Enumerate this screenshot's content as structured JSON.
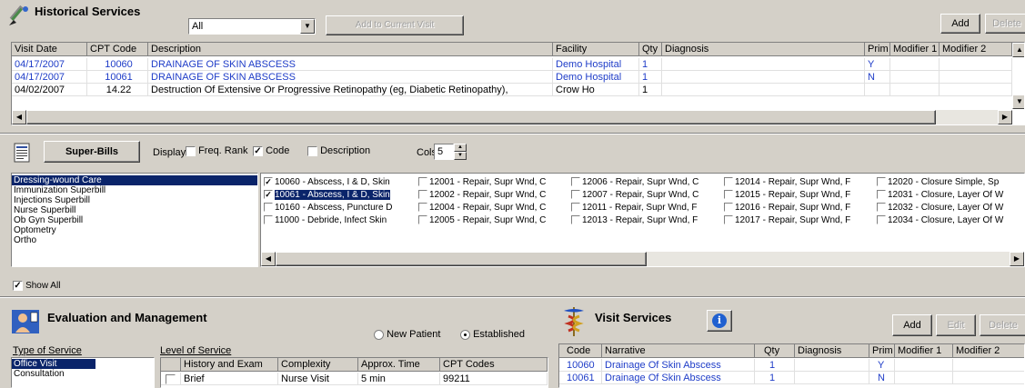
{
  "historical": {
    "title": "Historical Services",
    "filter_value": "All",
    "add_current_label": "Add to Current Visit",
    "add_label": "Add",
    "delete_label": "Delete",
    "columns": [
      "Visit Date",
      "CPT Code",
      "Description",
      "Facility",
      "Qty",
      "Diagnosis",
      "Prim",
      "Modifier 1",
      "Modifier 2"
    ],
    "rows": [
      {
        "date": "04/17/2007",
        "cpt": "10060",
        "desc": "DRAINAGE OF SKIN ABSCESS",
        "facility": "Demo Hospital",
        "qty": "1",
        "diag": "",
        "prim": "Y",
        "mod1": "",
        "mod2": ""
      },
      {
        "date": "04/17/2007",
        "cpt": "10061",
        "desc": "DRAINAGE OF SKIN ABSCESS",
        "facility": "Demo Hospital",
        "qty": "1",
        "diag": "",
        "prim": "N",
        "mod1": "",
        "mod2": ""
      },
      {
        "date": "04/02/2007",
        "cpt": "14.22",
        "desc": "Destruction Of Extensive Or Progressive Retinopathy (eg, Diabetic Retinopathy),",
        "facility": "Crow Ho",
        "qty": "1",
        "diag": "",
        "prim": "",
        "mod1": "",
        "mod2": ""
      }
    ]
  },
  "superbills": {
    "button_label": "Super-Bills",
    "display_label": "Display",
    "freq_rank_label": "Freq. Rank",
    "freq_rank_checked": false,
    "code_label": "Code",
    "code_checked": true,
    "description_label": "Description",
    "description_checked": false,
    "cols_label": "Cols",
    "cols_value": "5",
    "list": [
      "Dressing-wound Care",
      "Immunization Superbill",
      "Injections Superbill",
      "Nurse Superbill",
      "Ob Gyn Superbill",
      "Optometry",
      "Ortho"
    ],
    "selected_list_index": 0,
    "grid": [
      [
        {
          "label": "10060 - Abscess, I & D, Skin",
          "checked": true
        },
        {
          "label": "10061 - Abscess, I & D, Skin",
          "checked": true
        },
        {
          "label": "10160 - Abscess, Puncture D",
          "checked": false
        },
        {
          "label": "11000 - Debride, Infect Skin",
          "checked": false
        }
      ],
      [
        {
          "label": "12001 - Repair, Supr Wnd, C",
          "checked": false
        },
        {
          "label": "12002 - Repair, Supr Wnd, C",
          "checked": false
        },
        {
          "label": "12004 - Repair, Supr Wnd, C",
          "checked": false
        },
        {
          "label": "12005 - Repair, Supr Wnd, C",
          "checked": false
        }
      ],
      [
        {
          "label": "12006 - Repair, Supr Wnd, C",
          "checked": false
        },
        {
          "label": "12007 - Repair, Supr Wnd, C",
          "checked": false
        },
        {
          "label": "12011 - Repair, Supr Wnd, F",
          "checked": false
        },
        {
          "label": "12013 - Repair, Supr Wnd, F",
          "checked": false
        }
      ],
      [
        {
          "label": "12014 - Repair, Supr Wnd, F",
          "checked": false
        },
        {
          "label": "12015 - Repair, Supr Wnd, F",
          "checked": false
        },
        {
          "label": "12016 - Repair, Supr Wnd, F",
          "checked": false
        },
        {
          "label": "12017 - Repair, Supr Wnd, F",
          "checked": false
        }
      ],
      [
        {
          "label": "12020 - Closure Simple, Sp",
          "checked": false
        },
        {
          "label": "12031 - Closure, Layer Of W",
          "checked": false
        },
        {
          "label": "12032 - Closure, Layer Of W",
          "checked": false
        },
        {
          "label": "12034 - Closure, Layer Of W",
          "checked": false
        }
      ]
    ],
    "show_all_label": "Show All",
    "show_all_checked": true
  },
  "em": {
    "title": "Evaluation and Management",
    "new_patient_label": "New Patient",
    "established_label": "Established",
    "established_selected": true,
    "type_label": "Type of Service",
    "types": [
      "Office Visit",
      "Consultation"
    ],
    "level_label": "Level of Service",
    "level_columns": [
      "History and Exam",
      "Complexity",
      "Approx. Time",
      "CPT Codes"
    ],
    "level_rows": [
      {
        "history": "Brief",
        "complexity": "Nurse Visit",
        "time": "5 min",
        "cpt": "99211"
      }
    ]
  },
  "visit": {
    "title": "Visit Services",
    "info_icon": "i",
    "add_label": "Add",
    "edit_label": "Edit",
    "delete_label": "Delete",
    "columns": [
      "Code",
      "Narrative",
      "Qty",
      "Diagnosis",
      "Prim",
      "Modifier 1",
      "Modifier 2"
    ],
    "rows": [
      {
        "code": "10060",
        "narrative": "Drainage Of Skin Abscess",
        "qty": "1",
        "diag": "",
        "prim": "Y",
        "mod1": "",
        "mod2": ""
      },
      {
        "code": "10061",
        "narrative": "Drainage Of Skin Abscess",
        "qty": "1",
        "diag": "",
        "prim": "N",
        "mod1": "",
        "mod2": ""
      }
    ]
  },
  "colors": {
    "link_blue": "#1f3dc8",
    "selection": "#0a246a",
    "chrome": "#d4d0c8"
  }
}
